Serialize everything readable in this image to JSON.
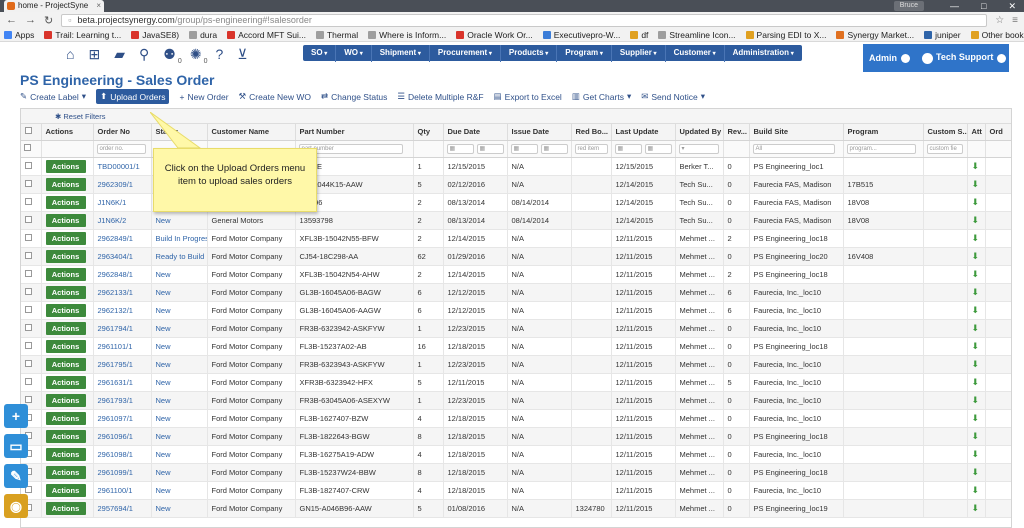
{
  "browser": {
    "tab_title": "home - ProjectSyne",
    "user_badge": "Bruce",
    "url_host": "beta.projectsynergy.com",
    "url_path": "/group/ps-engineering#!salesorder",
    "bookmarks": [
      {
        "label": "Apps",
        "color": "#4285f4"
      },
      {
        "label": "Trail: Learning t...",
        "color": "#d9342b"
      },
      {
        "label": "JavaSE8)",
        "color": "#d9342b"
      },
      {
        "label": "dura",
        "color": "#9e9e9e"
      },
      {
        "label": "Accord MFT Sui...",
        "color": "#d9342b"
      },
      {
        "label": "Thermal",
        "color": "#9e9e9e"
      },
      {
        "label": "Where is Inform...",
        "color": "#9e9e9e"
      },
      {
        "label": "Oracle Work Or...",
        "color": "#d9342b"
      },
      {
        "label": "Executivepro-W...",
        "color": "#3b7dd8"
      },
      {
        "label": "df",
        "color": "#e0a020"
      },
      {
        "label": "Streamline Icon...",
        "color": "#9e9e9e"
      },
      {
        "label": "Parsing EDI to X...",
        "color": "#e0a020"
      },
      {
        "label": "Synergy Market...",
        "color": "#e07020"
      },
      {
        "label": "juniper",
        "color": "#2f64a8"
      }
    ],
    "other_bookmarks": "Other bookmarks"
  },
  "nav": {
    "icon_counts": {
      "users": "0",
      "ops": "0",
      "alerts": "0"
    },
    "menu": [
      "SO",
      "WO",
      "Shipment",
      "Procurement",
      "Products",
      "Program",
      "Supplier",
      "Customer",
      "Administration"
    ],
    "admin_label": "Admin",
    "support_label": "Tech Support"
  },
  "page": {
    "title": "PS Engineering - Sales Order",
    "toolbar": [
      {
        "label": "Create Label",
        "icon": "tag-icon",
        "caret": true
      },
      {
        "label": "Upload Orders",
        "icon": "upload-icon",
        "caret": false,
        "active": true
      },
      {
        "label": "New Order",
        "icon": "plus-icon",
        "caret": false
      },
      {
        "label": "Create New WO",
        "icon": "wrench-icon",
        "caret": false
      },
      {
        "label": "Change Status",
        "icon": "swap-icon",
        "caret": false
      },
      {
        "label": "Delete Multiple R&F",
        "icon": "list-icon",
        "caret": false
      },
      {
        "label": "Export to Excel",
        "icon": "doc-icon",
        "caret": false
      },
      {
        "label": "Get Charts",
        "icon": "chart-icon",
        "caret": true
      },
      {
        "label": "Send Notice",
        "icon": "mail-icon",
        "caret": true
      }
    ],
    "reset_filters": "Reset Filters"
  },
  "tooltip": "Click on the Upload Orders menu item to upload sales orders",
  "grid": {
    "columns": [
      "",
      "Actions",
      "Order No",
      "Status",
      "Customer Name",
      "Part Number",
      "Qty",
      "Due Date",
      "Issue Date",
      "Red Bo...",
      "Last Update",
      "Updated By",
      "Rev...",
      "Build Site",
      "Program",
      "Custom S...",
      "Att",
      "Ord"
    ],
    "filters": {
      "order_no": "order no.",
      "part": "part number",
      "red": "red item",
      "build_site": "All",
      "program": "program...",
      "custom": "custom fie"
    },
    "action_label": "Actions",
    "rows": [
      [
        "TBD00001/1",
        "",
        "",
        "...EME",
        "1",
        "12/15/2015",
        "N/A",
        "",
        "12/15/2015",
        "Berker T...",
        "0",
        "PS Engineering_loc1",
        "",
        ""
      ],
      [
        "2962309/1",
        "",
        "",
        "...5-A044K15-AAW",
        "5",
        "02/12/2016",
        "N/A",
        "",
        "12/14/2015",
        "Tech Su...",
        "0",
        "Faurecia FAS, Madison",
        "17B515",
        ""
      ],
      [
        "J1N6K/1",
        "",
        "",
        "...3796",
        "2",
        "08/13/2014",
        "08/14/2014",
        "",
        "12/14/2015",
        "Tech Su...",
        "0",
        "Faurecia FAS, Madison",
        "18V08",
        ""
      ],
      [
        "J1N6K/2",
        "New",
        "General Motors",
        "13593798",
        "2",
        "08/13/2014",
        "08/14/2014",
        "",
        "12/14/2015",
        "Tech Su...",
        "0",
        "Faurecia FAS, Madison",
        "18V08",
        ""
      ],
      [
        "2962849/1",
        "Build In Progres",
        "Ford Motor Company",
        "XFL3B-15042N55-BFW",
        "2",
        "12/14/2015",
        "N/A",
        "",
        "12/11/2015",
        "Mehmet ...",
        "2",
        "PS Engineering_loc18",
        "",
        ""
      ],
      [
        "2963404/1",
        "Ready to Build",
        "Ford Motor Company",
        "CJ54-18C298-AA",
        "62",
        "01/29/2016",
        "N/A",
        "",
        "12/11/2015",
        "Mehmet ...",
        "0",
        "PS Engineering_loc20",
        "16V408",
        ""
      ],
      [
        "2962848/1",
        "New",
        "Ford Motor Company",
        "XFL3B-15042N54-AHW",
        "2",
        "12/14/2015",
        "N/A",
        "",
        "12/11/2015",
        "Mehmet ...",
        "2",
        "PS Engineering_loc18",
        "",
        ""
      ],
      [
        "2962133/1",
        "New",
        "Ford Motor Company",
        "GL3B-16045A06-BAGW",
        "6",
        "12/12/2015",
        "N/A",
        "",
        "12/11/2015",
        "Mehmet ...",
        "6",
        "Faurecia, Inc._loc10",
        "",
        ""
      ],
      [
        "2962132/1",
        "New",
        "Ford Motor Company",
        "GL3B-16045A06-AAGW",
        "6",
        "12/12/2015",
        "N/A",
        "",
        "12/11/2015",
        "Mehmet ...",
        "6",
        "Faurecia, Inc._loc10",
        "",
        ""
      ],
      [
        "2961794/1",
        "New",
        "Ford Motor Company",
        "FR3B-6323942-ASKFYW",
        "1",
        "12/23/2015",
        "N/A",
        "",
        "12/11/2015",
        "Mehmet ...",
        "0",
        "Faurecia, Inc._loc10",
        "",
        ""
      ],
      [
        "2961101/1",
        "New",
        "Ford Motor Company",
        "FL3B-15237A02-AB",
        "16",
        "12/18/2015",
        "N/A",
        "",
        "12/11/2015",
        "Mehmet ...",
        "0",
        "PS Engineering_loc18",
        "",
        ""
      ],
      [
        "2961795/1",
        "New",
        "Ford Motor Company",
        "FR3B-6323943-ASKFYW",
        "1",
        "12/23/2015",
        "N/A",
        "",
        "12/11/2015",
        "Mehmet ...",
        "0",
        "Faurecia, Inc._loc10",
        "",
        ""
      ],
      [
        "2961631/1",
        "New",
        "Ford Motor Company",
        "XFR3B-6323942-HFX",
        "5",
        "12/11/2015",
        "N/A",
        "",
        "12/11/2015",
        "Mehmet ...",
        "5",
        "Faurecia, Inc._loc10",
        "",
        ""
      ],
      [
        "2961793/1",
        "New",
        "Ford Motor Company",
        "FR3B-63045A06-ASEXYW",
        "1",
        "12/23/2015",
        "N/A",
        "",
        "12/11/2015",
        "Mehmet ...",
        "0",
        "Faurecia, Inc._loc10",
        "",
        ""
      ],
      [
        "2961097/1",
        "New",
        "Ford Motor Company",
        "FL3B-1627407-BZW",
        "4",
        "12/18/2015",
        "N/A",
        "",
        "12/11/2015",
        "Mehmet ...",
        "0",
        "Faurecia, Inc._loc10",
        "",
        ""
      ],
      [
        "2961096/1",
        "New",
        "Ford Motor Company",
        "FL3B-1822643-BGW",
        "8",
        "12/18/2015",
        "N/A",
        "",
        "12/11/2015",
        "Mehmet ...",
        "0",
        "PS Engineering_loc18",
        "",
        ""
      ],
      [
        "2961098/1",
        "New",
        "Ford Motor Company",
        "FL3B-16275A19-ADW",
        "4",
        "12/18/2015",
        "N/A",
        "",
        "12/11/2015",
        "Mehmet ...",
        "0",
        "Faurecia, Inc._loc10",
        "",
        ""
      ],
      [
        "2961099/1",
        "New",
        "Ford Motor Company",
        "FL3B-15237W24-BBW",
        "8",
        "12/18/2015",
        "N/A",
        "",
        "12/11/2015",
        "Mehmet ...",
        "0",
        "PS Engineering_loc18",
        "",
        ""
      ],
      [
        "2961100/1",
        "New",
        "Ford Motor Company",
        "FL3B-1827407-CRW",
        "4",
        "12/18/2015",
        "N/A",
        "",
        "12/11/2015",
        "Mehmet ...",
        "0",
        "Faurecia, Inc._loc10",
        "",
        ""
      ],
      [
        "2957694/1",
        "New",
        "Ford Motor Company",
        "GN15-A046B96-AAW",
        "5",
        "01/08/2016",
        "N/A",
        "1324780",
        "12/11/2015",
        "Mehmet ...",
        "0",
        "PS Engineering_loc19",
        "",
        ""
      ]
    ]
  },
  "floating": [
    {
      "icon": "plus-icon",
      "color": "#2f8fd8",
      "glyph": "+"
    },
    {
      "icon": "monitor-icon",
      "color": "#2f8fd8",
      "glyph": "▭"
    },
    {
      "icon": "edit-icon",
      "color": "#2f8fd8",
      "glyph": "✎"
    },
    {
      "icon": "eye-slash-icon",
      "color": "#d9a020",
      "glyph": "◉"
    }
  ]
}
